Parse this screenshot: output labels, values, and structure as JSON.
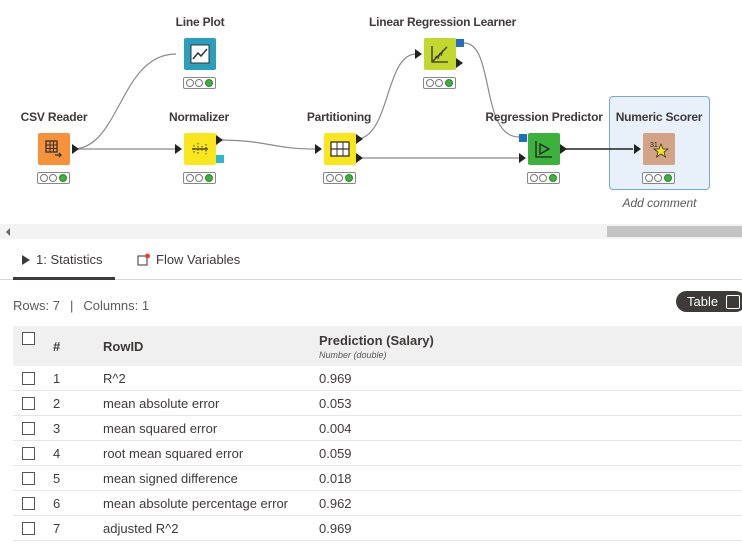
{
  "workflow": {
    "nodes": {
      "csv_reader": {
        "title": "CSV Reader",
        "color": "#f7923a"
      },
      "line_plot": {
        "title": "Line Plot",
        "color": "#2a9fbc"
      },
      "normalizer": {
        "title": "Normalizer",
        "color": "#fae61c"
      },
      "partitioning": {
        "title": "Partitioning",
        "color": "#fae61c"
      },
      "linear_regression_learner": {
        "title": "Linear Regression Learner",
        "color": "#c2d82e"
      },
      "regression_predictor": {
        "title": "Regression Predictor",
        "color": "#3cb23c"
      },
      "numeric_scorer": {
        "title": "Numeric Scorer",
        "color": "#d2a384"
      }
    },
    "add_comment": "Add comment"
  },
  "tabs": {
    "statistics": "1: Statistics",
    "flow_variables": "Flow Variables"
  },
  "info": {
    "rows": "Rows: 7",
    "separator": "|",
    "columns": "Columns: 1"
  },
  "toggle": {
    "label": "Table"
  },
  "table": {
    "headers": {
      "index": "#",
      "rowid": "RowID",
      "column": "Prediction (Salary)",
      "column_type": "Number (double)"
    },
    "rows": [
      {
        "n": "1",
        "id": "R^2",
        "v": "0.969"
      },
      {
        "n": "2",
        "id": "mean absolute error",
        "v": "0.053"
      },
      {
        "n": "3",
        "id": "mean squared error",
        "v": "0.004"
      },
      {
        "n": "4",
        "id": "root mean squared error",
        "v": "0.059"
      },
      {
        "n": "5",
        "id": "mean signed difference",
        "v": "0.018"
      },
      {
        "n": "6",
        "id": "mean absolute percentage error",
        "v": "0.962"
      },
      {
        "n": "7",
        "id": "adjusted R^2",
        "v": "0.969"
      }
    ]
  }
}
